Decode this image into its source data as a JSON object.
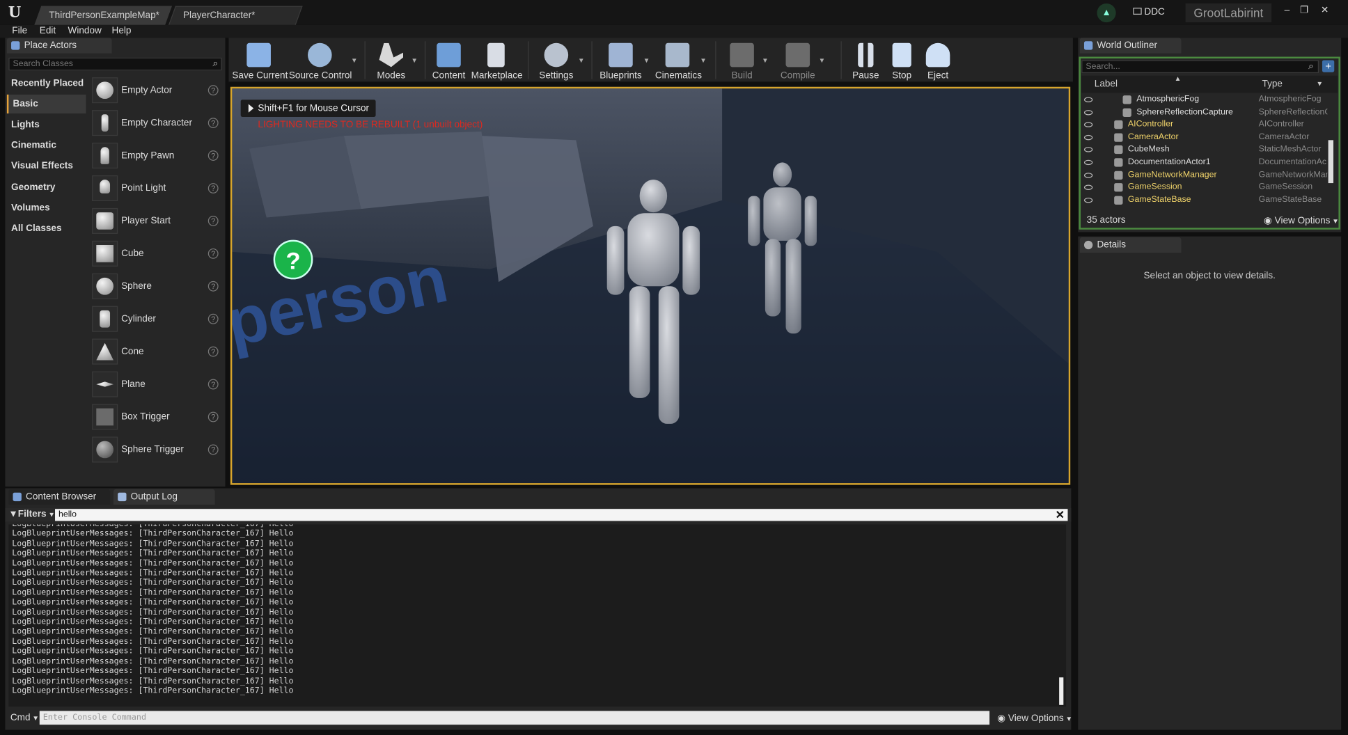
{
  "titlebar": {
    "tabs": [
      {
        "label": "ThirdPersonExampleMap*"
      },
      {
        "label": "PlayerCharacter*"
      }
    ],
    "ddc_label": "DDC",
    "project_name": "GrootLabirint",
    "window_buttons": [
      "–",
      "❐",
      "✕"
    ]
  },
  "menu": [
    "File",
    "Edit",
    "Window",
    "Help"
  ],
  "place_actors": {
    "tab_label": "Place Actors",
    "search_placeholder": "Search Classes",
    "categories": [
      "Recently Placed",
      "Basic",
      "Lights",
      "Cinematic",
      "Visual Effects",
      "Geometry",
      "Volumes",
      "All Classes"
    ],
    "selected_category": "Basic",
    "actors": [
      "Empty Actor",
      "Empty Character",
      "Empty Pawn",
      "Point Light",
      "Player Start",
      "Cube",
      "Sphere",
      "Cylinder",
      "Cone",
      "Plane",
      "Box Trigger",
      "Sphere Trigger"
    ]
  },
  "toolbar": [
    {
      "label": "Save Current",
      "icon": "save-icon",
      "color": "#8bb3e6"
    },
    {
      "label": "Source Control",
      "icon": "source-control-icon",
      "color": "#9ab7d8"
    },
    {
      "label": "Modes",
      "icon": "modes-icon",
      "color": "#d9d9d9"
    },
    {
      "label": "Content",
      "icon": "content-icon",
      "color": "#6e9ed8"
    },
    {
      "label": "Marketplace",
      "icon": "marketplace-icon",
      "color": "#d9dde5"
    },
    {
      "label": "Settings",
      "icon": "settings-icon",
      "color": "#b9c2cf"
    },
    {
      "label": "Blueprints",
      "icon": "blueprints-icon",
      "color": "#9fb4d4"
    },
    {
      "label": "Cinematics",
      "icon": "cinematics-icon",
      "color": "#a8b8cc"
    },
    {
      "label": "Build",
      "icon": "build-icon",
      "color": "#6c6c6c"
    },
    {
      "label": "Compile",
      "icon": "compile-icon",
      "color": "#6c6c6c"
    },
    {
      "label": "Pause",
      "icon": "pause-icon",
      "color": "#d8dfea"
    },
    {
      "label": "Stop",
      "icon": "stop-icon",
      "color": "#cfe0f5"
    },
    {
      "label": "Eject",
      "icon": "eject-icon",
      "color": "#cfe0f5"
    }
  ],
  "viewport": {
    "hint": "Shift+F1 for Mouse Cursor",
    "warning": "LIGHTING NEEDS TO BE REBUILT (1 unbuilt object)",
    "floor_text": "person"
  },
  "world_outliner": {
    "tab_label": "World Outliner",
    "search_placeholder": "Search...",
    "col_label": "Label",
    "col_type": "Type",
    "rows": [
      {
        "label": "AtmosphericFog",
        "type": "AtmosphericFog",
        "yellow": false,
        "indent": true
      },
      {
        "label": "SphereReflectionCapture",
        "type": "SphereReflectionC",
        "yellow": false,
        "indent": true
      },
      {
        "label": "AIController",
        "type": "AIController",
        "yellow": true,
        "indent": false
      },
      {
        "label": "CameraActor",
        "type": "CameraActor",
        "yellow": true,
        "indent": false
      },
      {
        "label": "CubeMesh",
        "type": "StaticMeshActor",
        "yellow": false,
        "indent": false
      },
      {
        "label": "DocumentationActor1",
        "type": "DocumentationAc",
        "yellow": false,
        "indent": false
      },
      {
        "label": "GameNetworkManager",
        "type": "GameNetworkMar",
        "yellow": true,
        "indent": false
      },
      {
        "label": "GameSession",
        "type": "GameSession",
        "yellow": true,
        "indent": false
      },
      {
        "label": "GameStateBase",
        "type": "GameStateBase",
        "yellow": true,
        "indent": false
      }
    ],
    "count": "35 actors",
    "view_options": "View Options"
  },
  "details": {
    "tab_label": "Details",
    "empty_message": "Select an object to view details."
  },
  "log": {
    "tabs": [
      "Content Browser",
      "Output Log"
    ],
    "filters_label": "Filters",
    "search_value": "hello",
    "line_text": "LogBlueprintUserMessages: [ThirdPersonCharacter_167] Hello",
    "line_count": 18,
    "cmd_label": "Cmd",
    "cmd_placeholder": "Enter Console Command",
    "view_options": "View Options"
  },
  "colors": {
    "accent": "#e6a33a",
    "selection_frame": "#d7a52c",
    "outliner_frame": "#4b8a3f",
    "warning": "#e0281e",
    "yellow_label": "#f0d36a"
  }
}
